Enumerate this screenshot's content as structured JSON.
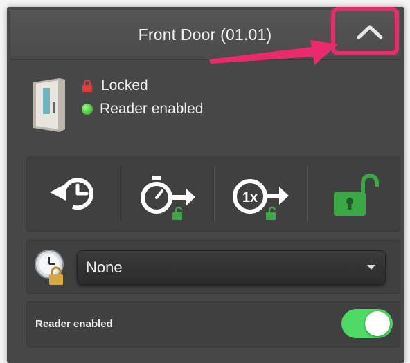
{
  "header": {
    "title": "Front Door (01.01)",
    "collapse_icon": "chevron-up-icon"
  },
  "status": {
    "lock_label": "Locked",
    "lock_icon": "padlock-locked-icon",
    "reader_label": "Reader enabled",
    "reader_indicator_color": "#3cc02c"
  },
  "actions": [
    {
      "name": "reset-timer",
      "icon": "clock-reset-icon"
    },
    {
      "name": "timed-unlock",
      "icon": "stopwatch-unlock-icon"
    },
    {
      "name": "single-unlock",
      "icon": "one-time-unlock-icon"
    },
    {
      "name": "permanent-unlock",
      "icon": "padlock-open-green-icon"
    }
  ],
  "schedule": {
    "icon": "clock-lock-icon",
    "selected": "None"
  },
  "reader": {
    "label": "Reader enabled",
    "enabled": true,
    "toggle_color": "#4cd964"
  },
  "colors": {
    "accent_green": "#3aa845",
    "highlight": "#ea2a6d"
  }
}
